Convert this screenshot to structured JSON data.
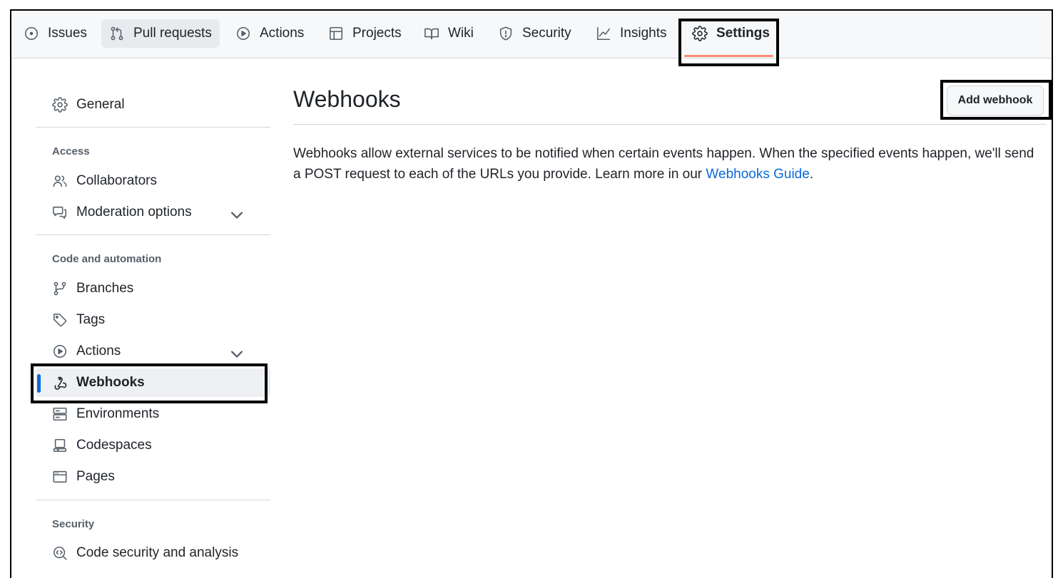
{
  "tabs": [
    {
      "label": "Issues",
      "icon": "issue-opened-icon"
    },
    {
      "label": "Pull requests",
      "icon": "git-pull-request-icon"
    },
    {
      "label": "Actions",
      "icon": "play-icon"
    },
    {
      "label": "Projects",
      "icon": "table-icon"
    },
    {
      "label": "Wiki",
      "icon": "book-icon"
    },
    {
      "label": "Security",
      "icon": "shield-icon"
    },
    {
      "label": "Insights",
      "icon": "graph-icon"
    },
    {
      "label": "Settings",
      "icon": "gear-icon",
      "active": true
    }
  ],
  "sidebar": {
    "general": "General",
    "access_heading": "Access",
    "collaborators": "Collaborators",
    "moderation": "Moderation options",
    "code_heading": "Code and automation",
    "branches": "Branches",
    "tags": "Tags",
    "actions": "Actions",
    "webhooks": "Webhooks",
    "environments": "Environments",
    "codespaces": "Codespaces",
    "pages": "Pages",
    "security_heading": "Security",
    "code_security": "Code security and analysis",
    "active_item": "Webhooks"
  },
  "main": {
    "title": "Webhooks",
    "add_button": "Add webhook",
    "description": "Webhooks allow external services to be notified when certain events happen. When the specified events happen, we'll send a POST request to each of the URLs you provide. Learn more in our ",
    "link_text": "Webhooks Guide",
    "description_end": "."
  },
  "colors": {
    "accent": "#0969da",
    "tab_underline": "#fd8c73",
    "highlight_border": "#000000"
  }
}
